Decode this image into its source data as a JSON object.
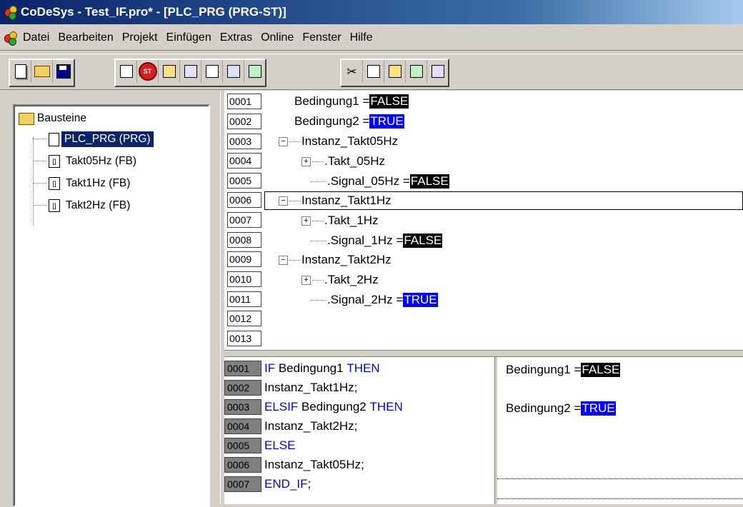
{
  "window": {
    "title": "CoDeSys - Test_IF.pro* - [PLC_PRG (PRG-ST)]"
  },
  "menu": [
    "Datei",
    "Bearbeiten",
    "Projekt",
    "Einfügen",
    "Extras",
    "Online",
    "Fenster",
    "Hilfe"
  ],
  "toolbar_icons": [
    "new-icon",
    "open-icon",
    "save-icon",
    "login-icon",
    "stop-icon",
    "step-icon",
    "breakpoint-icon",
    "print-icon",
    "compile-icon",
    "find-icon",
    "cut-icon",
    "copy-icon",
    "paste-icon",
    "search-icon",
    "replace-icon"
  ],
  "tree": {
    "root": "Bausteine",
    "items": [
      "PLC_PRG (PRG)",
      "Takt05Hz (FB)",
      "Takt1Hz (FB)",
      "Takt2Hz (FB)"
    ],
    "selected": 0
  },
  "declaration": {
    "line_numbers": [
      "0001",
      "0002",
      "0003",
      "0004",
      "0005",
      "0006",
      "0007",
      "0008",
      "0009",
      "0010",
      "0011",
      "0012",
      "0013"
    ],
    "lines": {
      "l1": {
        "label": "Bedingung1 = ",
        "value": "FALSE"
      },
      "l2": {
        "label": "Bedingung2 = ",
        "value": "TRUE"
      },
      "l3": {
        "label": "Instanz_Takt05Hz"
      },
      "l4": {
        "label": ".Takt_05Hz"
      },
      "l5": {
        "label": ".Signal_05Hz = ",
        "value": "FALSE"
      },
      "l6": {
        "label": "Instanz_Takt1Hz"
      },
      "l7": {
        "label": ".Takt_1Hz"
      },
      "l8": {
        "label": ".Signal_1Hz = ",
        "value": "FALSE"
      },
      "l9": {
        "label": "Instanz_Takt2Hz"
      },
      "l10": {
        "label": ".Takt_2Hz"
      },
      "l11": {
        "label": ".Signal_2Hz = ",
        "value": "TRUE"
      }
    }
  },
  "code": {
    "line_numbers": [
      "0001",
      "0002",
      "0003",
      "0004",
      "0005",
      "0006",
      "0007"
    ],
    "lines": {
      "c1_kw": "IF",
      "c1_text": " Bedingung1 ",
      "c1_kw2": "THEN",
      "c2_text": "Instanz_Takt1Hz;",
      "c3_kw": "ELSIF",
      "c3_text": " Bedingung2 ",
      "c3_kw2": "THEN",
      "c4_text": "Instanz_Takt2Hz;",
      "c5_kw": "ELSE",
      "c6_text": "Instanz_Takt05Hz;",
      "c7_kw": "END_IF",
      "c7_text": ";"
    }
  },
  "monitor": {
    "m1": {
      "label": "Bedingung1 = ",
      "value": "FALSE"
    },
    "m3": {
      "label": "Bedingung2 = ",
      "value": "TRUE"
    }
  },
  "colors": {
    "true_bg": "#0000ff",
    "false_bg": "#000000",
    "keyword": "#0000ff",
    "title_start": "#0a246a"
  }
}
